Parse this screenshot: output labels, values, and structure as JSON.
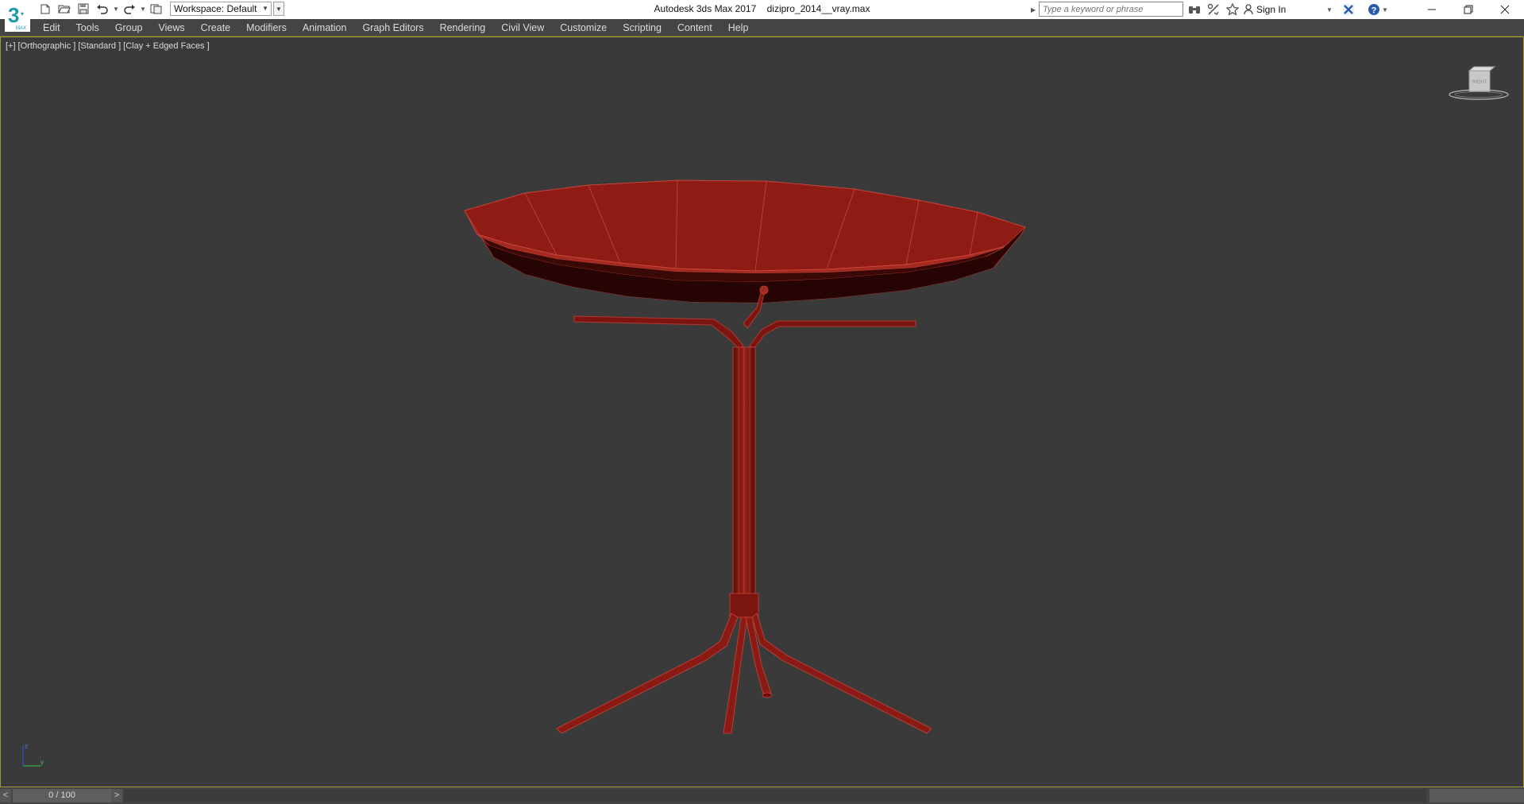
{
  "title_bar": {
    "app_name": "Autodesk 3ds Max 2017",
    "file_name": "dizipro_2014__vray.max",
    "logo_text": "3",
    "workspace_label": "Workspace: Default",
    "search_placeholder": "Type a keyword or phrase",
    "signin_label": "Sign In",
    "icons": [
      "new-file-icon",
      "open-file-icon",
      "save-icon",
      "undo-icon",
      "redo-icon",
      "project-folder-icon",
      "binoculars-icon",
      "communication-center-icon",
      "favorites-star-icon",
      "user-icon",
      "autodesk-exchange-icon",
      "help-icon",
      "minimize-icon",
      "restore-icon",
      "close-icon"
    ]
  },
  "menu": {
    "items": [
      "Edit",
      "Tools",
      "Group",
      "Views",
      "Create",
      "Modifiers",
      "Animation",
      "Graph Editors",
      "Rendering",
      "Civil View",
      "Customize",
      "Scripting",
      "Content",
      "Help"
    ]
  },
  "viewport": {
    "label_plus": "[+]",
    "label_view": "[Orthographic ]",
    "label_shading": "[Standard ]",
    "label_style": "[Clay + Edged Faces ]",
    "viewcube_face": "RIGHT",
    "axis_labels": {
      "y": "y",
      "z": "z"
    },
    "object_color": "#8a1a14",
    "edge_color": "#d8483e",
    "background": "#3a3a3a"
  },
  "timeline": {
    "prev": "<",
    "frame_display": "0 / 100",
    "next": ">"
  }
}
